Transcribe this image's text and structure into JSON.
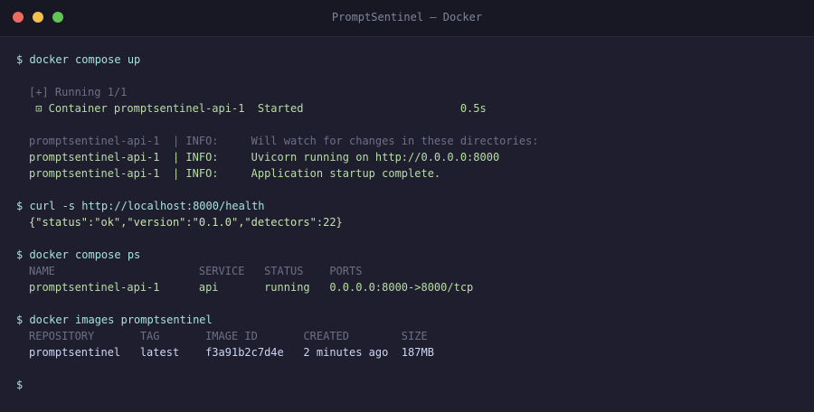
{
  "window": {
    "title": "PromptSentinel — Docker"
  },
  "terminal": {
    "cmd1": "$ docker compose up",
    "running": "[+] Running 1/1",
    "container": " ⊡ Container promptsentinel-api-1  Started                        0.5s",
    "log1": "promptsentinel-api-1  | INFO:     Will watch for changes in these directories:",
    "log2": "promptsentinel-api-1  | INFO:     Uvicorn running on http://0.0.0.0:8000",
    "log3": "promptsentinel-api-1  | INFO:     Application startup complete.",
    "cmd2": "$ curl -s http://localhost:8000/health",
    "health": "{\"status\":\"ok\",\"version\":\"0.1.0\",\"detectors\":22}",
    "cmd3": "$ docker compose ps",
    "ps_header": "NAME                      SERVICE   STATUS    PORTS",
    "ps_row": "promptsentinel-api-1      api       running   0.0.0.0:8000->8000/tcp",
    "cmd4": "$ docker images promptsentinel",
    "img_header": "REPOSITORY       TAG       IMAGE ID       CREATED        SIZE",
    "img_row": "promptsentinel   latest    f3a91b2c7d4e   2 minutes ago  187MB",
    "prompt": "$"
  },
  "colors": {
    "background": "#1e1e2e",
    "titlebar": "#181825",
    "command": "#a6e3d9",
    "dim": "#6c7086",
    "info": "#b9dda4"
  }
}
